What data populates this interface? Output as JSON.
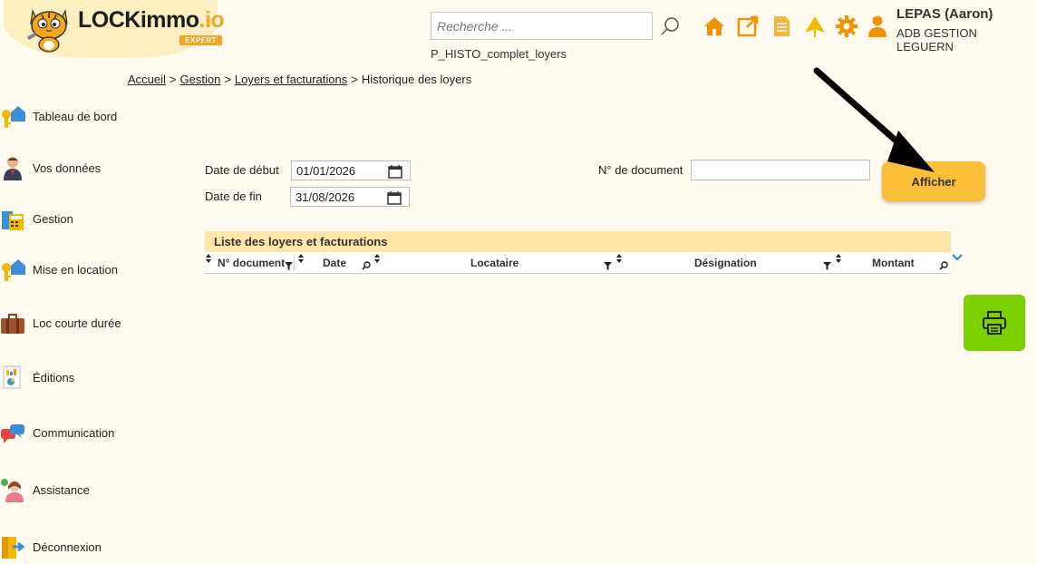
{
  "app": {
    "brand_main": "LOCKimmo",
    "brand_suffix": ".io",
    "brand_badge": "EXPERT"
  },
  "header": {
    "search_placeholder": "Recherche ...",
    "page_code": "P_HISTO_complet_loyers",
    "icons": [
      "home-icon",
      "external-link-icon",
      "document-icon",
      "pin-icon",
      "gear-icon",
      "user-icon"
    ],
    "user_name": "LEPAS (Aaron)",
    "user_org": "ADB GESTION LEGUERN"
  },
  "breadcrumb": {
    "items": [
      "Accueil",
      "Gestion",
      "Loyers et facturations"
    ],
    "current": "Historique des loyers"
  },
  "sidebar": {
    "items": [
      {
        "label": "Tableau de bord",
        "icon": "key-house-icon"
      },
      {
        "label": "Vos données",
        "icon": "person-icon"
      },
      {
        "label": "Gestion",
        "icon": "calculator-icon"
      },
      {
        "label": "Mise en location",
        "icon": "key-house-icon"
      },
      {
        "label": "Loc courte durée",
        "icon": "suitcase-icon"
      },
      {
        "label": "Éditions",
        "icon": "report-icon"
      },
      {
        "label": "Communication",
        "icon": "chat-icon"
      },
      {
        "label": "Assistance",
        "icon": "support-agent-icon"
      },
      {
        "label": "Déconnexion",
        "icon": "logout-icon"
      }
    ]
  },
  "form": {
    "start_label": "Date de début",
    "start_value": "01/01/2026",
    "end_label": "Date de fin",
    "end_value": "31/08/2026",
    "doc_label": "N° de document",
    "doc_value": "",
    "submit_label": "Afficher"
  },
  "table": {
    "title": "Liste des loyers et facturations",
    "columns": [
      "N° document",
      "Date",
      "Locataire",
      "Désignation",
      "Montant"
    ],
    "rows": []
  },
  "colors": {
    "background": "#fffbf1",
    "accent_orange": "#f5a623",
    "button_yellow": "#fbbf3a",
    "table_title_bg": "#fde6a8",
    "print_green": "#7cd000"
  }
}
